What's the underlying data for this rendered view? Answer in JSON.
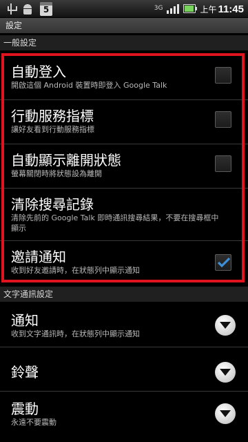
{
  "status_bar": {
    "calendar_day": "5",
    "network": "3G",
    "ampm": "上午",
    "time": "11:45"
  },
  "title": "設定",
  "sections": {
    "general": "一般設定",
    "text": "文字通訊設定"
  },
  "general_items": [
    {
      "title": "自動登入",
      "subtitle": "開啟這個 Android 裝置時即登入 Google Talk",
      "checked": false
    },
    {
      "title": "行動服務指標",
      "subtitle": "讓好友看到行動服務指標",
      "checked": false
    },
    {
      "title": "自動顯示離開狀態",
      "subtitle": "螢幕關閉時將狀態設為離開",
      "checked": false
    },
    {
      "title": "清除搜尋記錄",
      "subtitle": "清除先前的 Google Talk 即時通訊搜尋結果，不要在搜尋框中顯示"
    },
    {
      "title": "邀請通知",
      "subtitle": "收到好友邀請時，在狀態列中顯示通知",
      "checked": true
    }
  ],
  "text_items": [
    {
      "title": "通知",
      "subtitle": "收到文字通訊時，在狀態列中顯示通知"
    },
    {
      "title": "鈴聲",
      "subtitle": ""
    },
    {
      "title": "震動",
      "subtitle": "永遠不要震動"
    }
  ],
  "colors": {
    "highlight_frame": "#e0141e",
    "check_mark": "#3d8fd6"
  }
}
